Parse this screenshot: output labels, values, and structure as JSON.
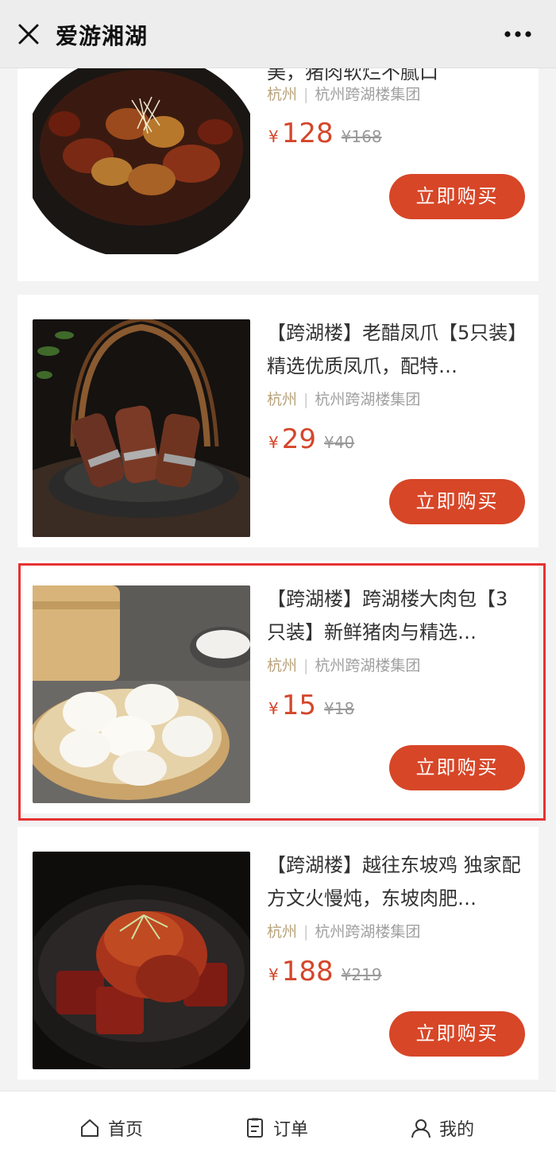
{
  "header": {
    "title": "爱游湘湖",
    "close_icon": "close-icon",
    "more_icon": "more-icon"
  },
  "products": [
    {
      "desc": "【跨湖楼】鲍鱼焖金蹄 鲍鱼鲜美，猪肉软烂不腻口",
      "city": "杭州",
      "separator": "|",
      "shop": "杭州跨湖楼集团",
      "currency": "¥",
      "price": "128",
      "old_currency": "¥",
      "old_price": "168",
      "buy_label": "立即购买"
    },
    {
      "desc": "【跨湖楼】老醋凤爪【5只装】精选优质凤爪，配特…",
      "city": "杭州",
      "separator": "|",
      "shop": "杭州跨湖楼集团",
      "currency": "¥",
      "price": "29",
      "old_currency": "¥",
      "old_price": "40",
      "buy_label": "立即购买"
    },
    {
      "desc": "【跨湖楼】跨湖楼大肉包【3只装】新鲜猪肉与精选…",
      "city": "杭州",
      "separator": "|",
      "shop": "杭州跨湖楼集团",
      "currency": "¥",
      "price": "15",
      "old_currency": "¥",
      "old_price": "18",
      "buy_label": "立即购买",
      "highlighted": true
    },
    {
      "desc": "【跨湖楼】越往东坡鸡 独家配方文火慢炖，东坡肉肥…",
      "city": "杭州",
      "separator": "|",
      "shop": "杭州跨湖楼集团",
      "currency": "¥",
      "price": "188",
      "old_currency": "¥",
      "old_price": "219",
      "buy_label": "立即购买"
    }
  ],
  "bottom_nav": [
    {
      "label": "首页",
      "icon": "home-icon"
    },
    {
      "label": "订单",
      "icon": "order-icon"
    },
    {
      "label": "我的",
      "icon": "user-icon"
    }
  ],
  "colors": {
    "accent": "#d74627",
    "price": "#d4462a",
    "city": "#b8a27a",
    "highlight_border": "#e53232"
  }
}
